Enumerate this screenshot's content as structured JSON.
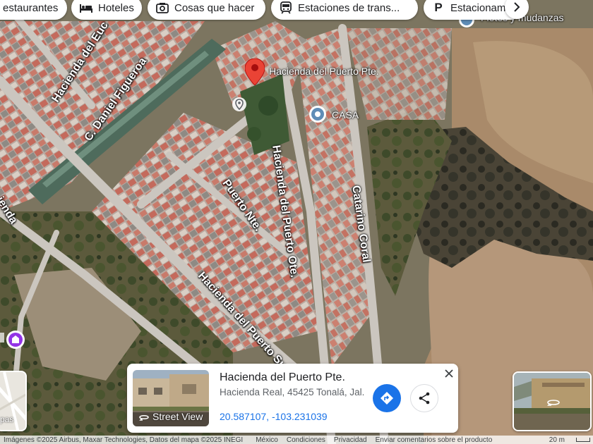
{
  "chips": [
    {
      "label": "estaurantes",
      "icon": "fork-knife-icon"
    },
    {
      "label": "Hoteles",
      "icon": "bed-icon"
    },
    {
      "label": "Cosas que hacer",
      "icon": "camera-icon"
    },
    {
      "label": "Estaciones de trans...",
      "icon": "transit-icon"
    },
    {
      "label": "Estacionam",
      "icon": "parking-icon"
    }
  ],
  "map": {
    "streets": {
      "hacienda_euc": "Hacienda del Euc",
      "daniel_figueroa": "C. Daniel Figueroa",
      "puerto_nte": "Puerto Nte.",
      "puerto_ote": "Hacienda del Puerto Ote.",
      "catarino_coral": "Catarino Coral",
      "puerto_sur": "Hacienda del Puerto Sur",
      "hacienda_left": "ienda"
    },
    "pins": {
      "selected": "Hacienda del Puerto Pte.",
      "casa": "CASA",
      "mudanzas": "Fletes y mudanzas"
    }
  },
  "card": {
    "title": "Hacienda del Puerto Pte.",
    "address": "Hacienda Real, 45425 Tonalá, Jal.",
    "coordinates": "20.587107, -103.231039",
    "street_view_label": "Street View"
  },
  "layers": {
    "label": "pas"
  },
  "footer": {
    "attribution": "Imágenes ©2025 Airbus, Maxar Technologies, Datos del mapa ©2025 INEGI",
    "links": [
      "México",
      "Condiciones",
      "Privacidad",
      "Enviar comentarios sobre el producto"
    ],
    "scale": "20 m"
  },
  "colors": {
    "accent": "#1a73e8",
    "pin_red": "#ea4335",
    "poi_purple": "#9334e6"
  }
}
